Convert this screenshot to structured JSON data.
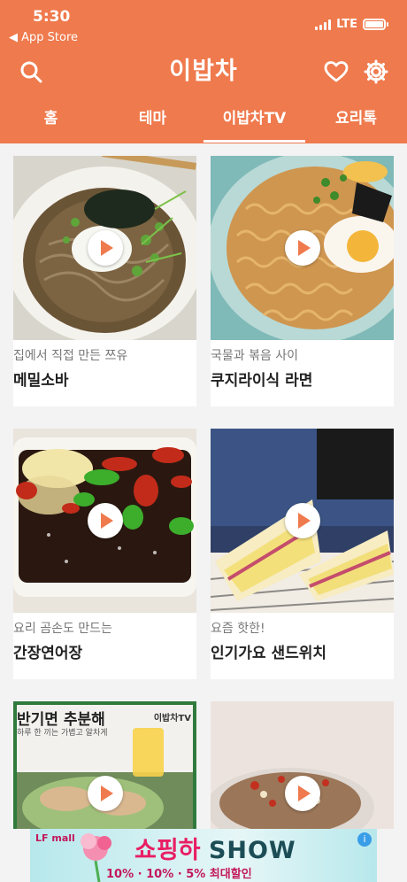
{
  "status_bar": {
    "time": "5:30",
    "back_label": "◀ App Store",
    "network": "LTE"
  },
  "header": {
    "title": "이밥차"
  },
  "tabs": [
    {
      "label": "홈",
      "active": false
    },
    {
      "label": "테마",
      "active": false
    },
    {
      "label": "이밥차TV",
      "active": true
    },
    {
      "label": "요리톡",
      "active": false
    }
  ],
  "cards": [
    {
      "subtitle": "집에서 직접 만든 쯔유",
      "name": "메밀소바"
    },
    {
      "subtitle": "국물과 볶음 사이",
      "name": "쿠지라이식 라면"
    },
    {
      "subtitle": "요리 곰손도 만드는",
      "name": "간장연어장"
    },
    {
      "subtitle": "요즘 핫한!",
      "name": "인기가요 샌드위치"
    },
    {
      "subtitle": "",
      "name": "",
      "overlay_title": "반기면 추분해",
      "overlay_sub": "하루 한 끼는 가볍고 알차게",
      "overlay_brand": "이밥차TV"
    },
    {
      "subtitle": "",
      "name": ""
    }
  ],
  "ad": {
    "brand": "LF mall",
    "headline": "쇼핑하",
    "headline_accent": "SHOW",
    "info": "i",
    "bottom_text": "10%  ·  10%  ·  5%  최대할인"
  },
  "colors": {
    "brand": "#ef7a4d",
    "background": "#f3f3f3"
  }
}
